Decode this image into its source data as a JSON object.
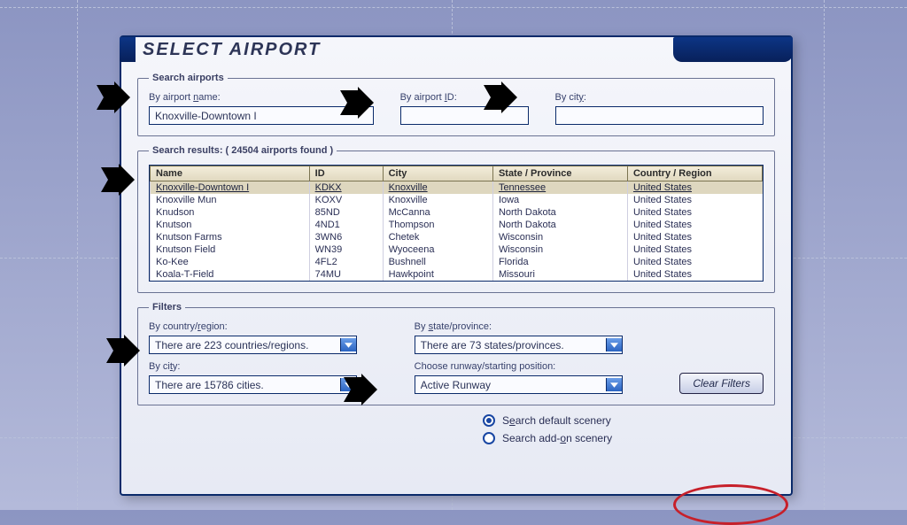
{
  "dialog": {
    "title": "SELECT AIRPORT"
  },
  "search": {
    "legend": "Search airports",
    "by_name_label_pre": "By airport ",
    "by_name_label_accel": "n",
    "by_name_label_post": "ame:",
    "by_name_value": "Knoxville-Downtown I",
    "by_id_label_pre": "By airport ",
    "by_id_label_accel": "I",
    "by_id_label_post": "D:",
    "by_id_value": "",
    "by_city_label_pre": "By cit",
    "by_city_label_accel": "y",
    "by_city_label_post": ":",
    "by_city_value": ""
  },
  "results": {
    "legend": "Search results: ( 24504 airports found )",
    "headers": {
      "name": "Name",
      "id": "ID",
      "city": "City",
      "state": "State / Province",
      "country": "Country / Region"
    },
    "rows": [
      {
        "name": "Knoxville-Downtown I",
        "id": "KDKX",
        "city": "Knoxville",
        "state": "Tennessee",
        "country": "United States",
        "selected": true
      },
      {
        "name": "Knoxville Mun",
        "id": "KOXV",
        "city": "Knoxville",
        "state": "Iowa",
        "country": "United States"
      },
      {
        "name": "Knudson",
        "id": "85ND",
        "city": "McCanna",
        "state": "North Dakota",
        "country": "United States"
      },
      {
        "name": "Knutson",
        "id": "4ND1",
        "city": "Thompson",
        "state": "North Dakota",
        "country": "United States"
      },
      {
        "name": "Knutson Farms",
        "id": "3WN6",
        "city": "Chetek",
        "state": "Wisconsin",
        "country": "United States"
      },
      {
        "name": "Knutson Field",
        "id": "WN39",
        "city": "Wyoceena",
        "state": "Wisconsin",
        "country": "United States"
      },
      {
        "name": "Ko-Kee",
        "id": "4FL2",
        "city": "Bushnell",
        "state": "Florida",
        "country": "United States"
      },
      {
        "name": "Koala-T-Field",
        "id": "74MU",
        "city": "Hawkpoint",
        "state": "Missouri",
        "country": "United States"
      }
    ]
  },
  "filters": {
    "legend": "Filters",
    "country_label_pre": "By country/",
    "country_label_accel": "r",
    "country_label_post": "egion:",
    "country_value": "There are 223 countries/regions.",
    "state_label_pre": "By ",
    "state_label_accel": "s",
    "state_label_post": "tate/province:",
    "state_value": "There are 73 states/provinces.",
    "city_label_pre": "By ci",
    "city_label_accel": "t",
    "city_label_post": "y:",
    "city_value": "There are 15786 cities.",
    "runway_label": "Choose runway/starting position:",
    "runway_value": "Active Runway",
    "clear_label": "Clear Filters"
  },
  "scenery": {
    "default_pre": "S",
    "default_accel": "e",
    "default_post": "arch default scenery",
    "addon_pre": "Search add-",
    "addon_accel": "o",
    "addon_post": "n scenery"
  }
}
